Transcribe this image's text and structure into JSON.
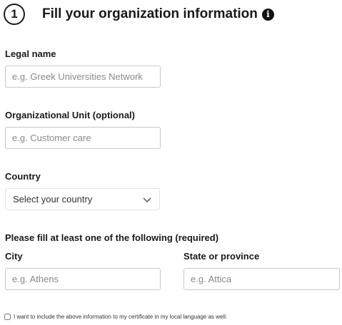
{
  "header": {
    "step_number": "1",
    "title": "Fill your organization information",
    "info_icon": "info-circle-icon"
  },
  "legal_name": {
    "label": "Legal name",
    "placeholder": "e.g. Greek Universities Network",
    "value": ""
  },
  "org_unit": {
    "label": "Organizational Unit (optional)",
    "placeholder": "e.g. Customer care",
    "value": ""
  },
  "country": {
    "label": "Country",
    "selected": "Select your country",
    "icon": "chevron-down-icon"
  },
  "location": {
    "heading": "Please fill at least one of the following (required)",
    "city": {
      "label": "City",
      "placeholder": "e.g. Athens",
      "value": ""
    },
    "state": {
      "label": "State or province",
      "placeholder": "e.g. Attica",
      "value": ""
    }
  },
  "local_language": {
    "label": "I want to include the above information to my certificate in my local language as well.",
    "checked": false
  },
  "colors": {
    "text": "#1a1a1a",
    "input_border": "#c8c8c8",
    "placeholder": "#8a8a8a"
  }
}
